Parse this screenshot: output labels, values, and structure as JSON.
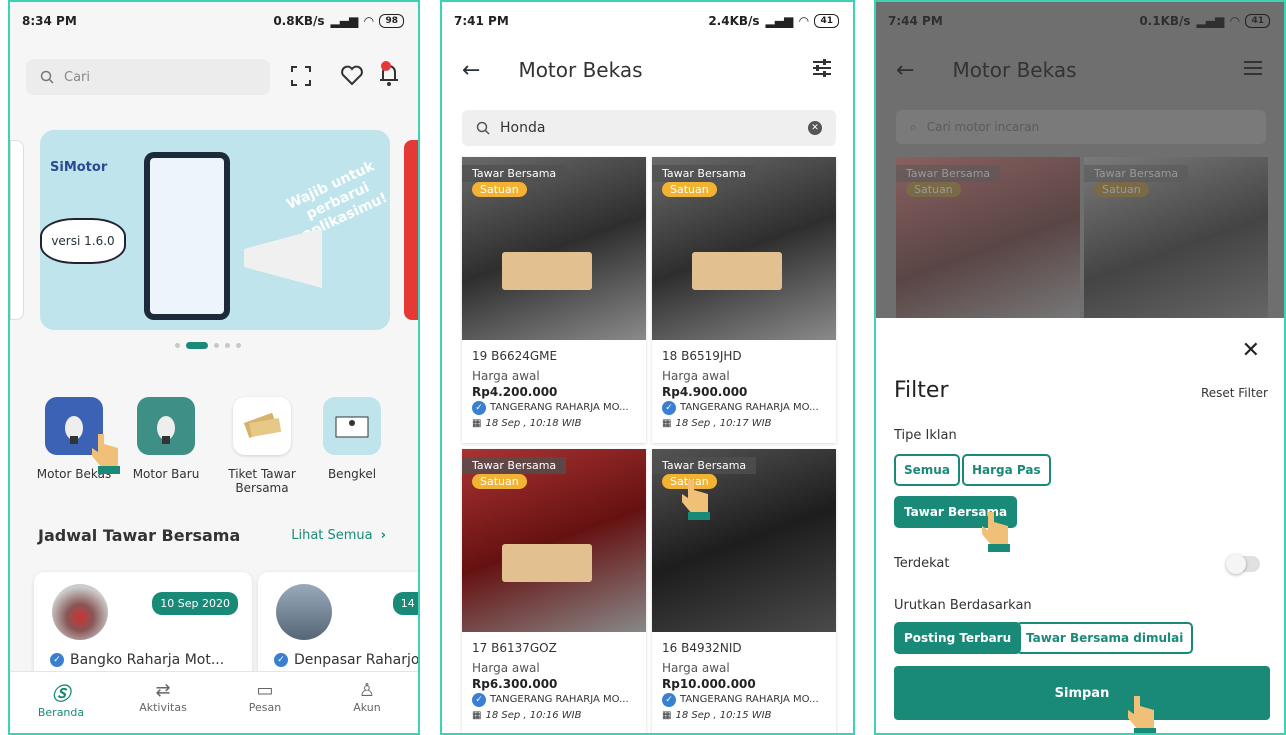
{
  "panel1": {
    "status": {
      "time": "8:34 PM",
      "speed": "0.8KB/s",
      "battery": "98"
    },
    "search_placeholder": "Cari",
    "banner": {
      "brand": "SiMotor",
      "version": "versi 1.6.0",
      "tagline": "Wajib untuk perbarui aplikasimu!"
    },
    "categories": [
      {
        "label": "Motor Bekas"
      },
      {
        "label": "Motor Baru"
      },
      {
        "label": "Tiket Tawar Bersama"
      },
      {
        "label": "Bengkel"
      }
    ],
    "section_title": "Jadwal Tawar Bersama",
    "see_all": "Lihat Semua",
    "schedule": [
      {
        "date": "10 Sep 2020",
        "title": "Bangko Raharja Mot..."
      },
      {
        "date": "14 Se",
        "title": "Denpasar Raharjo"
      }
    ],
    "nav": [
      {
        "label": "Beranda"
      },
      {
        "label": "Aktivitas"
      },
      {
        "label": "Pesan"
      },
      {
        "label": "Akun"
      }
    ]
  },
  "panel2": {
    "status": {
      "time": "7:41 PM",
      "speed": "2.4KB/s",
      "battery": "41"
    },
    "title": "Motor Bekas",
    "search_value": "Honda",
    "products": [
      {
        "tag": "Tawar Bersama",
        "sub": "Satuan",
        "plate": "19 B6624GME",
        "price_label": "Harga awal",
        "price": "Rp4.200.000",
        "dealer": "TANGERANG RAHARJA MO...",
        "date": "18 Sep , 10:18 WIB"
      },
      {
        "tag": "Tawar Bersama",
        "sub": "Satuan",
        "plate": "18 B6519JHD",
        "price_label": "Harga awal",
        "price": "Rp4.900.000",
        "dealer": "TANGERANG RAHARJA MO...",
        "date": "18 Sep , 10:17 WIB"
      },
      {
        "tag": "Tawar Bersama",
        "sub": "Satuan",
        "plate": "17 B6137GOZ",
        "price_label": "Harga awal",
        "price": "Rp6.300.000",
        "dealer": "TANGERANG RAHARJA MO...",
        "date": "18 Sep , 10:16 WIB"
      },
      {
        "tag": "Tawar Bersama",
        "sub": "Satuan",
        "plate": "16 B4932NID",
        "price_label": "Harga awal",
        "price": "Rp10.000.000",
        "dealer": "TANGERANG RAHARJA MO...",
        "date": "18 Sep , 10:15 WIB"
      }
    ]
  },
  "panel3": {
    "status": {
      "time": "7:44 PM",
      "speed": "0.1KB/s",
      "battery": "41"
    },
    "title": "Motor Bekas",
    "search_placeholder": "Cari motor incaran",
    "tag": "Tawar Bersama",
    "sub": "Satuan",
    "filter_title": "Filter",
    "reset": "Reset Filter",
    "type_label": "Tipe Iklan",
    "type_chips": [
      "Semua",
      "Harga Pas",
      "Tawar Bersama"
    ],
    "nearest_label": "Terdekat",
    "sort_label": "Urutkan Berdasarkan",
    "sort_chips": [
      "Posting Terbaru",
      "Tawar Bersama dimulai"
    ],
    "save": "Simpan"
  },
  "colors": {
    "primary": "#1a8a78",
    "frame": "#3ed2b5",
    "badge": "#f2b233"
  }
}
